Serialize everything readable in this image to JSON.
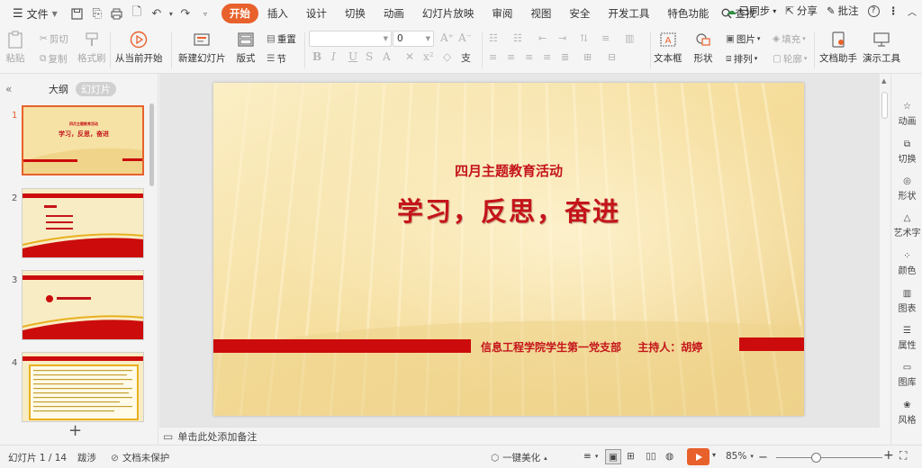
{
  "menubar": {
    "file_label": "文件",
    "tabs": [
      {
        "label": "开始",
        "active": true
      },
      {
        "label": "插入"
      },
      {
        "label": "设计"
      },
      {
        "label": "切换"
      },
      {
        "label": "动画"
      },
      {
        "label": "幻灯片放映"
      },
      {
        "label": "审阅"
      },
      {
        "label": "视图"
      },
      {
        "label": "安全"
      },
      {
        "label": "开发工具"
      },
      {
        "label": "特色功能"
      }
    ],
    "search_label": "查找",
    "sync_label": "已同步",
    "share_label": "分享",
    "comment_label": "批注"
  },
  "ribbon": {
    "paste": "粘贴",
    "cut": "剪切",
    "copy": "复制",
    "format_painter": "格式刷",
    "play_from_current": "从当前开始",
    "new_slide": "新建幻灯片",
    "layout": "版式",
    "reset": "重置",
    "section": "节",
    "font_size_value": "0",
    "text_box": "文本框",
    "shape": "形状",
    "picture": "图片",
    "fill": "填充",
    "arrange": "排列",
    "outline": "轮廓",
    "doc_assistant": "文档助手",
    "present_tools": "演示工具"
  },
  "left_panel": {
    "tab_outline": "大纲",
    "tab_slides": "幻灯片",
    "slide_numbers": [
      "1",
      "2",
      "3",
      "4"
    ]
  },
  "slide": {
    "subtitle": "四月主题教育活动",
    "title": "学习，反思，奋进",
    "org": "信息工程学院学生第一党支部",
    "host": "主持人：胡婷"
  },
  "notes_placeholder": "单击此处添加备注",
  "right_rail": [
    "动画",
    "切换",
    "形状",
    "艺术字",
    "颜色",
    "图表",
    "属性",
    "图库",
    "风格"
  ],
  "status": {
    "slide_count": "幻灯片 1 / 14",
    "theme": "跋涉",
    "protect": "文档未保护",
    "beautify": "一键美化",
    "zoom": "85%"
  },
  "colors": {
    "accent": "#e8612c",
    "slide_red": "#c4141a",
    "slide_bg": "#f6e2a5"
  }
}
